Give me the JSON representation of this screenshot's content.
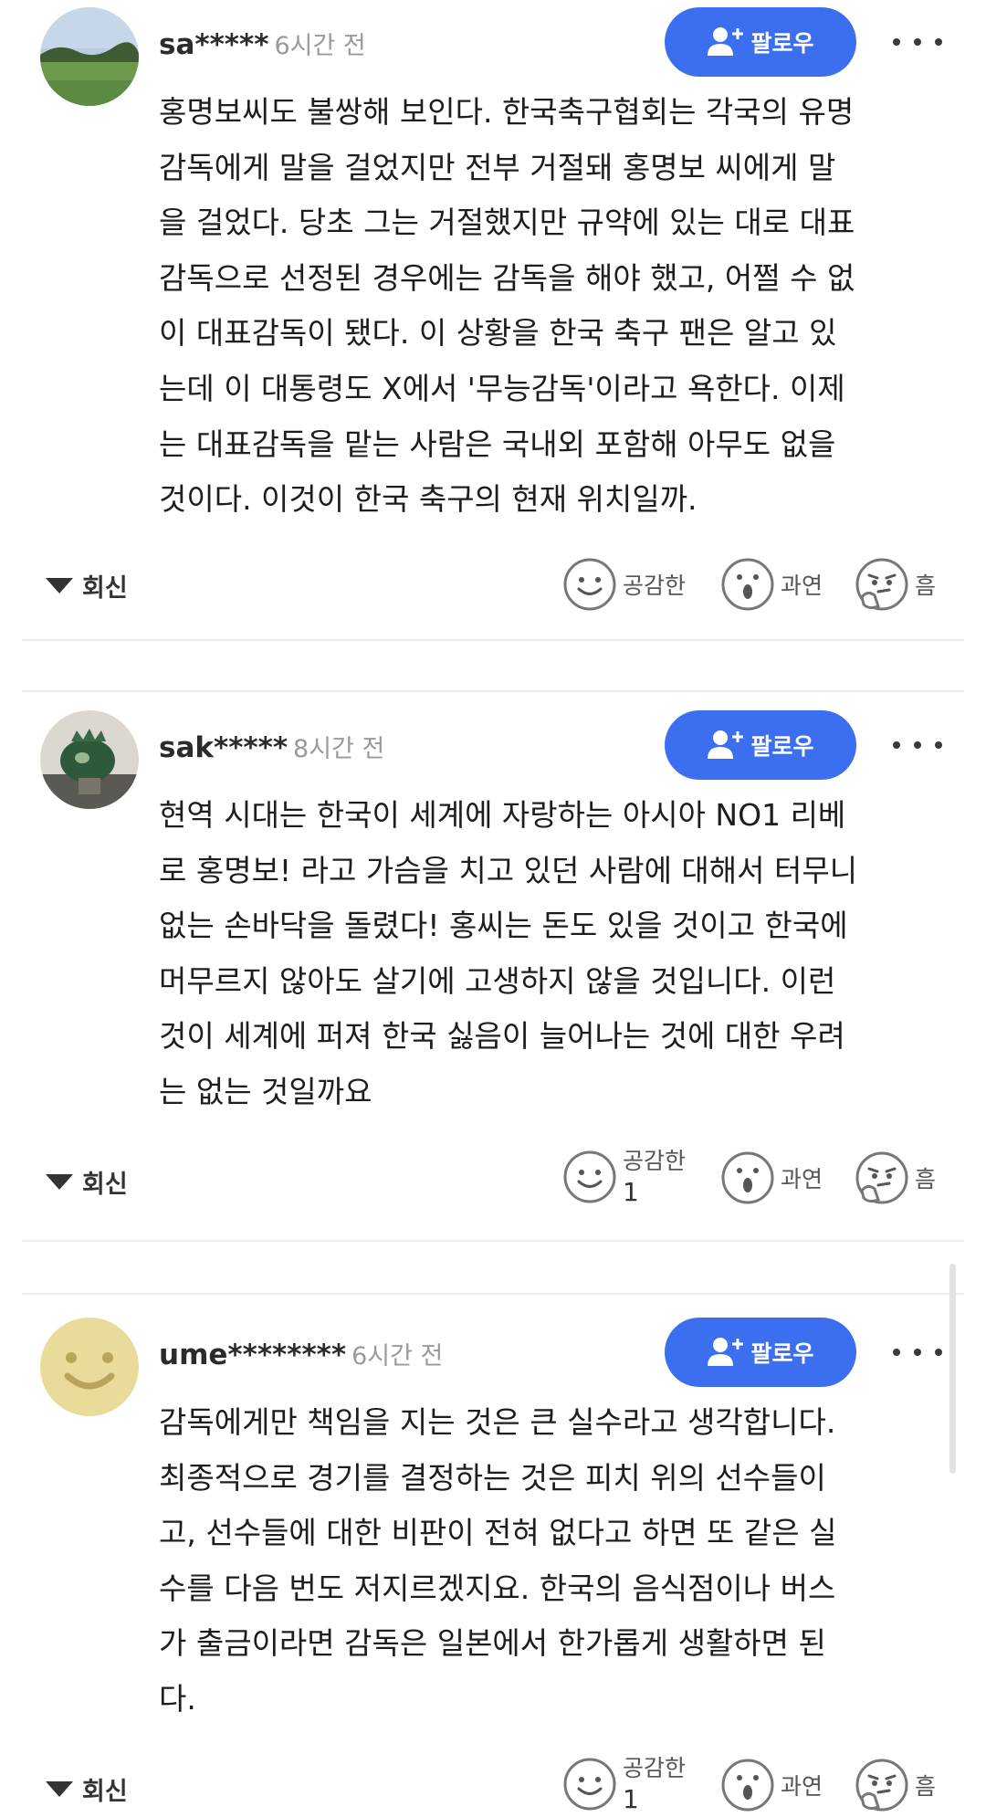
{
  "follow_label": "팔로우",
  "reply_label": "회신",
  "reactions": {
    "like": "공감한",
    "wow": "과연",
    "hmm": "흠"
  },
  "accent_color": "#3b6ff0",
  "comments": [
    {
      "username": "sa*****",
      "time": "6시간 전",
      "lines": [
        "홍명보씨도 불쌍해 보인다. 한국축구협회는 각국의 유명",
        "감독에게 말을 걸었지만 전부 거절돼 홍명보 씨에게 말",
        "을 걸었다. 당초 그는 거절했지만 규약에 있는 대로 대표",
        "감독으로 선정된 경우에는 감독을 해야 했고, 어쩔 수 없",
        "이 대표감독이 됐다. 이 상황을 한국 축구 팬은 알고 있",
        "는데 이 대통령도 X에서 '무능감독'이라고 욕한다. 이제",
        "는 대표감독을 맡는 사람은 국내외 포함해 아무도 없을",
        "것이다. 이것이 한국 축구의 현재 위치일까."
      ],
      "like_count": ""
    },
    {
      "username": "sak*****",
      "time": "8시간 전",
      "lines": [
        "현역 시대는 한국이 세계에 자랑하는 아시아 NO1 리베",
        "로 홍명보! 라고 가슴을 치고 있던 사람에 대해서 터무니",
        "없는 손바닥을 돌렸다! 홍씨는 돈도 있을 것이고 한국에",
        "머무르지 않아도 살기에 고생하지 않을 것입니다. 이런",
        "것이 세계에 퍼져 한국 싫음이 늘어나는 것에 대한 우려",
        "는 없는 것일까요"
      ],
      "like_count": "1"
    },
    {
      "username": "ume********",
      "time": "6시간 전",
      "lines": [
        "감독에게만 책임을 지는 것은 큰 실수라고 생각합니다.",
        "최종적으로 경기를 결정하는 것은 피치 위의 선수들이",
        "고, 선수들에 대한 비판이 전혀 없다고 하면 또 같은 실",
        "수를 다음 번도 저지르겠지요. 한국의 음식점이나 버스",
        "가 출금이라면 감독은 일본에서 한가롭게 생활하면 된",
        "다."
      ],
      "like_count": "1"
    }
  ]
}
